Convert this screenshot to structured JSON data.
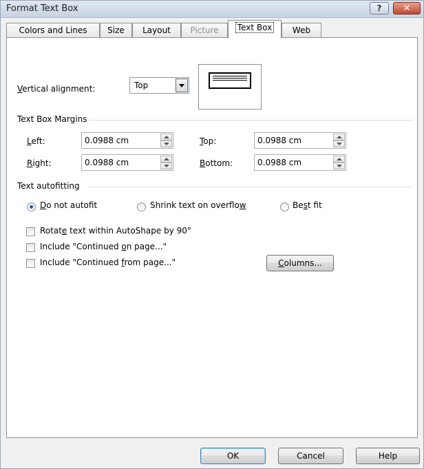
{
  "window": {
    "title": "Format Text Box",
    "help_glyph": "?",
    "close_glyph": "✕"
  },
  "tabs": [
    {
      "label": "Colors and Lines",
      "state": "normal"
    },
    {
      "label": "Size",
      "state": "normal"
    },
    {
      "label": "Layout",
      "state": "normal"
    },
    {
      "label": "Picture",
      "state": "disabled"
    },
    {
      "label": "Text Box",
      "state": "active"
    },
    {
      "label": "Web",
      "state": "normal"
    }
  ],
  "vertical_alignment": {
    "label_mnemonic": "V",
    "label_rest": "ertical alignment:",
    "value": "Top"
  },
  "margins": {
    "section_title": "Text Box Margins",
    "left": {
      "mn": "L",
      "rest": "eft:",
      "value": "0.0988 cm"
    },
    "right": {
      "mn": "R",
      "rest": "ight:",
      "value": "0.0988 cm"
    },
    "top": {
      "mn": "T",
      "rest": "op:",
      "value": "0.0988 cm"
    },
    "bottom": {
      "mn": "B",
      "rest": "ottom:",
      "value": "0.0988 cm"
    }
  },
  "autofit": {
    "section_title": "Text autofitting",
    "options": [
      {
        "pre": "",
        "mn": "D",
        "post": "o not autofit",
        "selected": true
      },
      {
        "pre": "Shrink text on overflo",
        "mn": "w",
        "post": "",
        "selected": false
      },
      {
        "pre": "Be",
        "mn": "s",
        "post": "t fit",
        "selected": false
      }
    ]
  },
  "checkboxes": [
    {
      "pre": "Rotat",
      "mn": "e",
      "post": " text within AutoShape by 90°",
      "checked": false
    },
    {
      "pre": "Include \"Continued ",
      "mn": "o",
      "post": "n page...\"",
      "checked": false
    },
    {
      "pre": "Include \"Continued ",
      "mn": "f",
      "post": "rom page...\"",
      "checked": false
    }
  ],
  "columns_button": {
    "mn": "C",
    "rest": "olumns..."
  },
  "footer": {
    "ok": "OK",
    "cancel": "Cancel",
    "help": "Help"
  }
}
